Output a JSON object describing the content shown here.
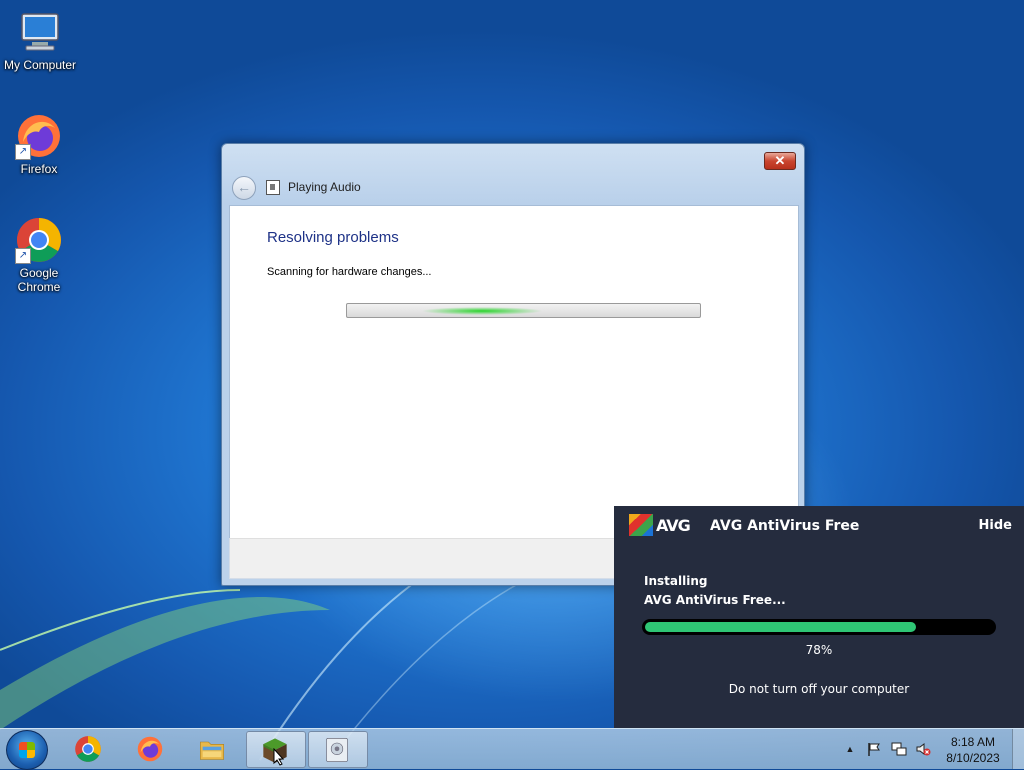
{
  "desktop": {
    "icons": [
      {
        "label": "My Computer",
        "icon": "computer-icon"
      },
      {
        "label": "Firefox",
        "icon": "firefox-icon"
      },
      {
        "label": "Google Chrome",
        "icon": "chrome-icon"
      }
    ]
  },
  "troubleshooter": {
    "title": "Playing Audio",
    "heading": "Resolving problems",
    "status": "Scanning for hardware changes...",
    "close_symbol": "✕",
    "back_symbol": "←"
  },
  "avg": {
    "logo_text": "AVG",
    "title": "AVG AntiVirus Free",
    "hide_label": "Hide",
    "line1": "Installing",
    "line2": "AVG AntiVirus Free...",
    "progress": 0.78,
    "progress_label": "78%",
    "warning": "Do not turn off your computer",
    "colors": {
      "background": "#252c3e",
      "bar_fill": "#2fc675"
    }
  },
  "taskbar": {
    "apps": [
      {
        "name": "Google Chrome",
        "icon": "chrome-icon",
        "active": false
      },
      {
        "name": "Firefox",
        "icon": "firefox-icon",
        "active": false
      },
      {
        "name": "File Explorer",
        "icon": "folder-icon",
        "active": false
      },
      {
        "name": "Minecraft-style block app",
        "icon": "grass-block-icon",
        "active": true
      },
      {
        "name": "Troubleshooter",
        "icon": "troubleshooter-icon",
        "active": true
      }
    ],
    "tray": {
      "icons": [
        "show-hidden-icons-icon",
        "action-center-flag-icon",
        "network-icon",
        "volume-muted-icon"
      ]
    },
    "clock": {
      "time": "8:18 AM",
      "date": "8/10/2023"
    }
  }
}
